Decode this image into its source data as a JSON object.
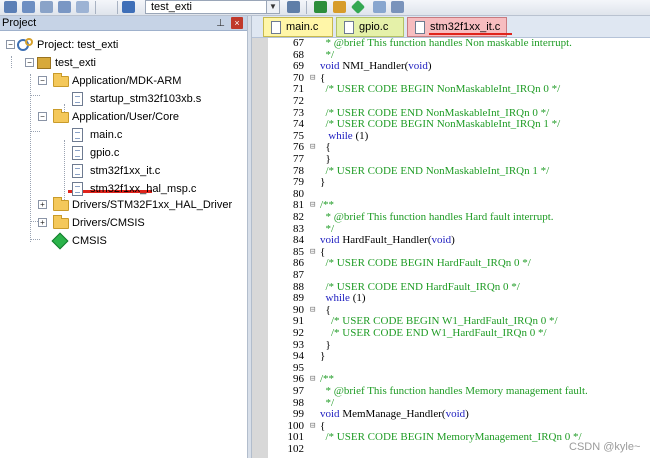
{
  "toolbar": {
    "target_name": "test_exti",
    "icons": [
      "save-icon",
      "save-all-icon",
      "print-icon",
      "window-icon",
      "load-icon",
      "build-icon",
      "rebuild-icon",
      "download-icon",
      "settings-icon",
      "diamond-icon",
      "cursor-icon"
    ]
  },
  "project_panel": {
    "title": "Project",
    "pin": "ⅅ",
    "close": "×",
    "tree": [
      {
        "label": "Project: test_exti",
        "expander": "−",
        "icon": "project-icon"
      },
      {
        "label": "test_exti",
        "expander": "−",
        "icon": "target-icon"
      },
      {
        "label": "Application/MDK-ARM",
        "expander": "−",
        "icon": "folder-icon"
      },
      {
        "label": "startup_stm32f103xb.s",
        "icon": "file-icon"
      },
      {
        "label": "Application/User/Core",
        "expander": "−",
        "icon": "folder-icon"
      },
      {
        "label": "main.c",
        "icon": "file-icon"
      },
      {
        "label": "gpio.c",
        "icon": "file-icon"
      },
      {
        "label": "stm32f1xx_it.c",
        "icon": "file-icon"
      },
      {
        "label": "stm32f1xx_hal_msp.c",
        "icon": "file-icon"
      },
      {
        "label": "Drivers/STM32F1xx_HAL_Driver",
        "expander": "+",
        "icon": "folder-icon"
      },
      {
        "label": "Drivers/CMSIS",
        "expander": "+",
        "icon": "folder-icon"
      },
      {
        "label": "CMSIS",
        "icon": "cmsis-icon"
      }
    ]
  },
  "tabs": [
    {
      "label": "main.c",
      "color": "#fff6a8"
    },
    {
      "label": "gpio.c",
      "color": "#e5f1a9"
    },
    {
      "label": "stm32f1xx_it.c",
      "color": "#f7bdc0",
      "active": true
    }
  ],
  "editor": {
    "colors": {
      "comment": "#1f9c25",
      "keyword": "#1c1cbf",
      "text": "#000000"
    },
    "lines": [
      {
        "n": "67",
        "fold": "",
        "parts": [
          {
            "t": "  * @brief This function handles Non maskable interrupt.",
            "s": "c"
          }
        ]
      },
      {
        "n": "68",
        "fold": "",
        "parts": [
          {
            "t": "  */",
            "s": "c"
          }
        ]
      },
      {
        "n": "69",
        "fold": "",
        "parts": [
          {
            "t": "void",
            "s": "k"
          },
          {
            "t": " NMI_Handler(",
            "s": "t"
          },
          {
            "t": "void",
            "s": "k"
          },
          {
            "t": ")",
            "s": "t"
          }
        ]
      },
      {
        "n": "70",
        "fold": "⊟",
        "parts": [
          {
            "t": "{",
            "s": "t"
          }
        ]
      },
      {
        "n": "71",
        "fold": "",
        "parts": [
          {
            "t": "  /* USER CODE BEGIN NonMaskableInt_IRQn 0 */",
            "s": "c"
          }
        ]
      },
      {
        "n": "72",
        "fold": "",
        "parts": []
      },
      {
        "n": "73",
        "fold": "",
        "parts": [
          {
            "t": "  /* USER CODE END NonMaskableInt_IRQn 0 */",
            "s": "c"
          }
        ]
      },
      {
        "n": "74",
        "fold": "",
        "parts": [
          {
            "t": "  /* USER CODE BEGIN NonMaskableInt_IRQn 1 */",
            "s": "c"
          }
        ]
      },
      {
        "n": "75",
        "fold": "",
        "parts": [
          {
            "t": "   while",
            "s": "k"
          },
          {
            "t": " (1)",
            "s": "t"
          }
        ]
      },
      {
        "n": "76",
        "fold": "⊟",
        "parts": [
          {
            "t": "  {",
            "s": "t"
          }
        ]
      },
      {
        "n": "77",
        "fold": "",
        "parts": [
          {
            "t": "  }",
            "s": "t"
          }
        ]
      },
      {
        "n": "78",
        "fold": "",
        "parts": [
          {
            "t": "  /* USER CODE END NonMaskableInt_IRQn 1 */",
            "s": "c"
          }
        ]
      },
      {
        "n": "79",
        "fold": "",
        "parts": [
          {
            "t": "}",
            "s": "t"
          }
        ]
      },
      {
        "n": "80",
        "fold": "",
        "parts": []
      },
      {
        "n": "81",
        "fold": "⊟",
        "parts": [
          {
            "t": "/**",
            "s": "c"
          }
        ]
      },
      {
        "n": "82",
        "fold": "",
        "parts": [
          {
            "t": "  * @brief This function handles Hard fault interrupt.",
            "s": "c"
          }
        ]
      },
      {
        "n": "83",
        "fold": "",
        "parts": [
          {
            "t": "  */",
            "s": "c"
          }
        ]
      },
      {
        "n": "84",
        "fold": "",
        "parts": [
          {
            "t": "void",
            "s": "k"
          },
          {
            "t": " HardFault_Handler(",
            "s": "t"
          },
          {
            "t": "void",
            "s": "k"
          },
          {
            "t": ")",
            "s": "t"
          }
        ]
      },
      {
        "n": "85",
        "fold": "⊟",
        "parts": [
          {
            "t": "{",
            "s": "t"
          }
        ]
      },
      {
        "n": "86",
        "fold": "",
        "parts": [
          {
            "t": "  /* USER CODE BEGIN HardFault_IRQn 0 */",
            "s": "c"
          }
        ]
      },
      {
        "n": "87",
        "fold": "",
        "parts": []
      },
      {
        "n": "88",
        "fold": "",
        "parts": [
          {
            "t": "  /* USER CODE END HardFault_IRQn 0 */",
            "s": "c"
          }
        ]
      },
      {
        "n": "89",
        "fold": "",
        "parts": [
          {
            "t": "  while",
            "s": "k"
          },
          {
            "t": " (1)",
            "s": "t"
          }
        ]
      },
      {
        "n": "90",
        "fold": "⊟",
        "parts": [
          {
            "t": "  {",
            "s": "t"
          }
        ]
      },
      {
        "n": "91",
        "fold": "",
        "parts": [
          {
            "t": "    /* USER CODE BEGIN W1_HardFault_IRQn 0 */",
            "s": "c"
          }
        ]
      },
      {
        "n": "92",
        "fold": "",
        "parts": [
          {
            "t": "    /* USER CODE END W1_HardFault_IRQn 0 */",
            "s": "c"
          }
        ]
      },
      {
        "n": "93",
        "fold": "",
        "parts": [
          {
            "t": "  }",
            "s": "t"
          }
        ]
      },
      {
        "n": "94",
        "fold": "",
        "parts": [
          {
            "t": "}",
            "s": "t"
          }
        ]
      },
      {
        "n": "95",
        "fold": "",
        "parts": []
      },
      {
        "n": "96",
        "fold": "⊟",
        "parts": [
          {
            "t": "/**",
            "s": "c"
          }
        ]
      },
      {
        "n": "97",
        "fold": "",
        "parts": [
          {
            "t": "  * @brief This function handles Memory management fault.",
            "s": "c"
          }
        ]
      },
      {
        "n": "98",
        "fold": "",
        "parts": [
          {
            "t": "  */",
            "s": "c"
          }
        ]
      },
      {
        "n": "99",
        "fold": "",
        "parts": [
          {
            "t": "void",
            "s": "k"
          },
          {
            "t": " MemManage_Handler(",
            "s": "t"
          },
          {
            "t": "void",
            "s": "k"
          },
          {
            "t": ")",
            "s": "t"
          }
        ]
      },
      {
        "n": "100",
        "fold": "⊟",
        "parts": [
          {
            "t": "{",
            "s": "t"
          }
        ]
      },
      {
        "n": "101",
        "fold": "",
        "parts": [
          {
            "t": "  /* USER CODE BEGIN MemoryManagement_IRQn 0 */",
            "s": "c"
          }
        ]
      },
      {
        "n": "102",
        "fold": "",
        "parts": []
      }
    ]
  },
  "watermark": "CSDN @kyle~"
}
